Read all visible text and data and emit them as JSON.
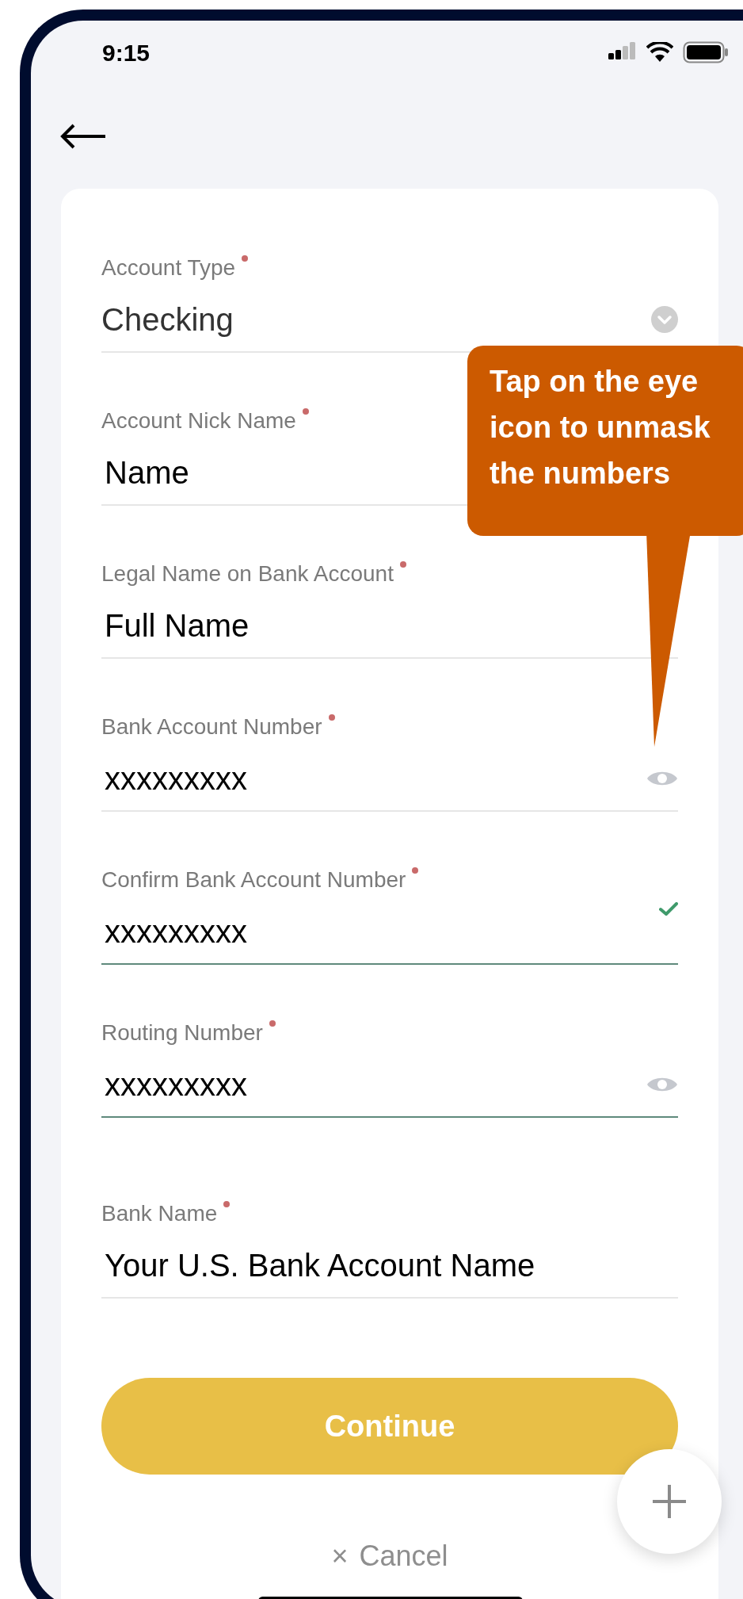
{
  "status_bar": {
    "time": "9:15"
  },
  "form": {
    "fields": [
      {
        "kind": "select",
        "label": "Account Type",
        "required": true,
        "value": "Checking",
        "active": false
      },
      {
        "kind": "text",
        "label": "Account Nick Name",
        "required": true,
        "value": "Name",
        "active": false
      },
      {
        "kind": "text",
        "label": "Legal Name on Bank Account",
        "required": true,
        "value": "Full Name",
        "active": false
      },
      {
        "kind": "masked",
        "label": "Bank Account Number",
        "required": true,
        "value": "xxxxxxxxx",
        "active": false
      },
      {
        "kind": "valid",
        "label": "Confirm Bank Account Number",
        "required": true,
        "value": "xxxxxxxxx",
        "active": true
      },
      {
        "kind": "masked",
        "label": "Routing Number",
        "required": true,
        "value": "xxxxxxxxx",
        "active": true
      },
      {
        "kind": "text",
        "label": "Bank Name",
        "required": true,
        "value": "Your U.S. Bank Account Name",
        "active": false
      }
    ],
    "continue_button": "Continue",
    "cancel": {
      "icon": "×",
      "label": "Cancel"
    }
  },
  "callout": {
    "text": "Tap on the eye icon to unmask the numbers"
  }
}
